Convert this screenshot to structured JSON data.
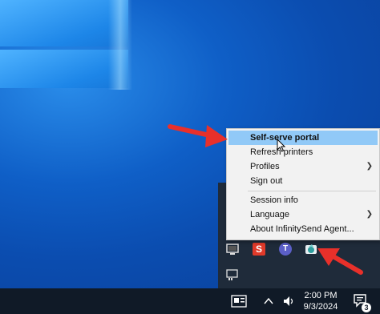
{
  "context_menu": {
    "items": [
      {
        "label": "Self-serve portal",
        "highlighted": true
      },
      {
        "label": "Refresh printers"
      },
      {
        "label": "Profiles",
        "submenu": true
      },
      {
        "label": "Sign out"
      },
      {
        "label": "Session info"
      },
      {
        "label": "Language",
        "submenu": true
      },
      {
        "label": "About InfinitySend Agent..."
      }
    ],
    "highlight_color": "#91c9f7"
  },
  "tray_icons": [
    {
      "name": "monitor-tray-icon"
    },
    {
      "name": "s-app-tray-icon",
      "glyph": "S",
      "color": "#e03a2a"
    },
    {
      "name": "teams-tray-icon",
      "glyph": "T",
      "color": "#5b5fc7"
    },
    {
      "name": "infinitysend-tray-icon"
    },
    {
      "name": "network-tray-icon"
    }
  ],
  "taskbar": {
    "time": "2:00 PM",
    "date": "9/3/2024",
    "notification_count": "3"
  },
  "annotation": {
    "arrow_color": "#e8302a"
  }
}
